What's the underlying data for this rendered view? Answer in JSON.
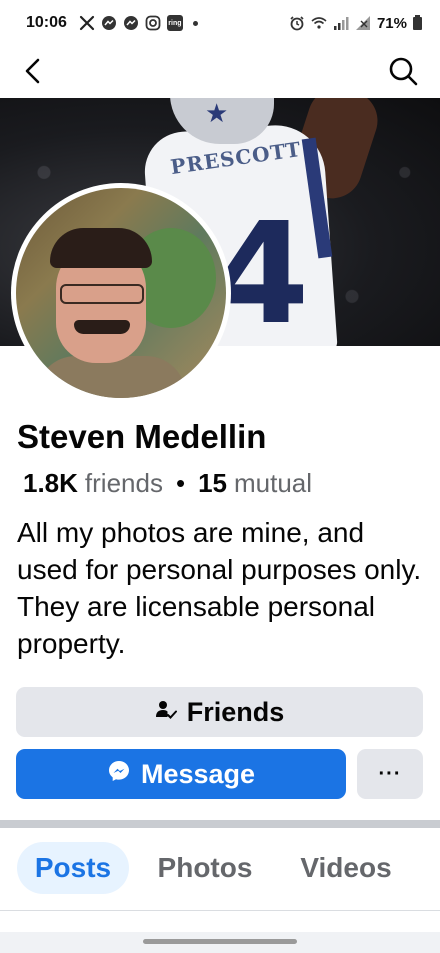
{
  "status_bar": {
    "time": "10:06",
    "notification_icons": [
      "x-icon",
      "messenger-icon",
      "messenger-icon",
      "instagram-icon",
      "ring-icon"
    ],
    "ring_label": "ring",
    "battery": "71%"
  },
  "profile": {
    "name": "Steven Medellin",
    "friends_count": "1.8K",
    "friends_label": "friends",
    "separator": "•",
    "mutual_count": "15",
    "mutual_label": "mutual",
    "bio": "All my photos are mine, and used for personal purposes only. They are licensable personal property.",
    "cover_jersey_name": "PRESCOTT",
    "cover_jersey_number": "4"
  },
  "actions": {
    "friends_label": "Friends",
    "message_label": "Message",
    "more_label": "···"
  },
  "tabs": [
    {
      "label": "Posts",
      "active": true
    },
    {
      "label": "Photos",
      "active": false
    },
    {
      "label": "Videos",
      "active": false
    }
  ],
  "colors": {
    "primary_blue": "#1b74e4",
    "button_grey": "#e4e6eb",
    "text_secondary": "#65676b",
    "active_tab_bg": "#e7f3ff"
  }
}
